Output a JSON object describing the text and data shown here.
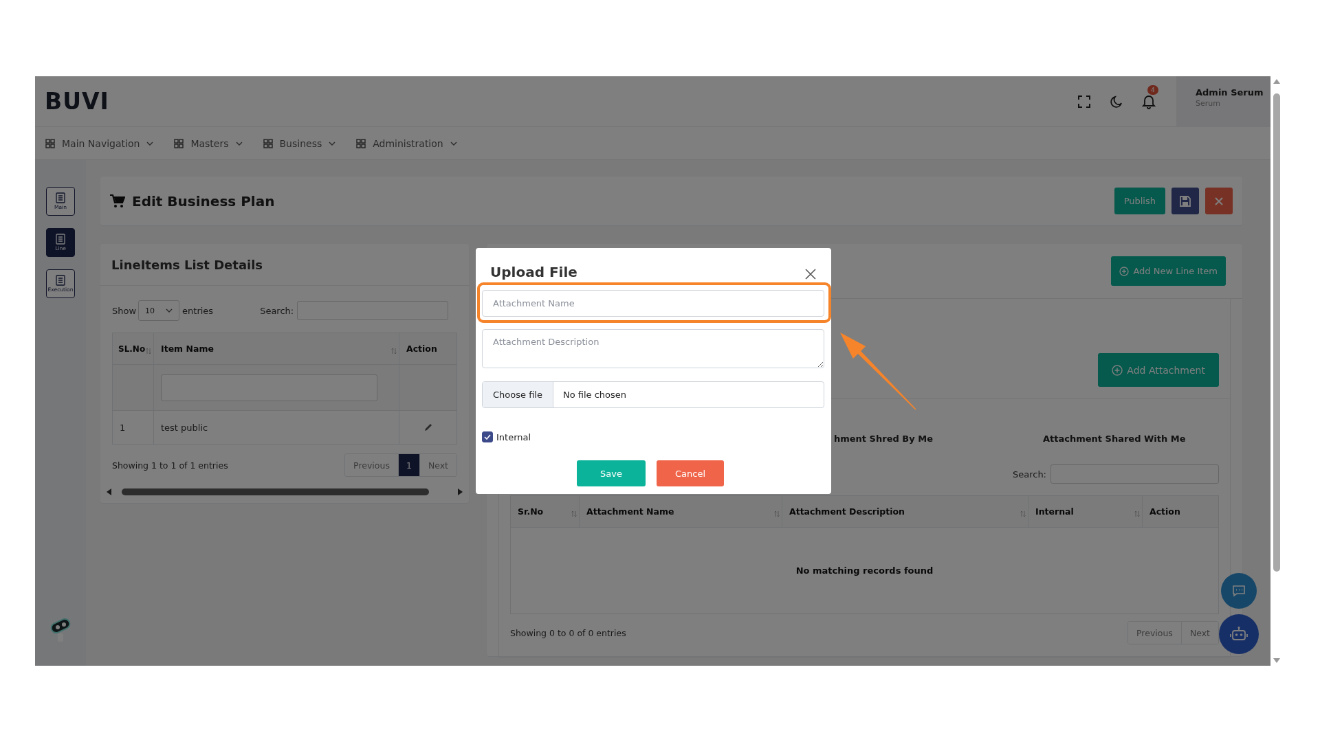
{
  "header": {
    "logo": "BUVI",
    "notification_count": "4",
    "user": {
      "name": "Admin Serum",
      "role": "Serum"
    }
  },
  "nav": [
    {
      "label": "Main Navigation"
    },
    {
      "label": "Masters"
    },
    {
      "label": "Business"
    },
    {
      "label": "Administration"
    }
  ],
  "side_rail": [
    {
      "label": "Main",
      "selected": false
    },
    {
      "label": "Line",
      "selected": true
    },
    {
      "label": "Execution",
      "selected": false
    }
  ],
  "page": {
    "title": "Edit Business Plan",
    "buttons": [
      {
        "kind": "publish",
        "label": "Publish"
      },
      {
        "kind": "save"
      },
      {
        "kind": "close"
      }
    ]
  },
  "line_items": {
    "title": "LineItems List Details",
    "show_label": "Show",
    "page_size": "10",
    "entries_label": "entries",
    "search_label": "Search:",
    "columns": [
      {
        "label": "SL.No",
        "sortable": true
      },
      {
        "label": "Item Name",
        "sortable": true
      },
      {
        "label": "Action",
        "sortable": false
      }
    ],
    "rows": [
      {
        "sl_no": "1",
        "item_name": "test public"
      }
    ],
    "info": "Showing 1 to 1 of 1 entries",
    "pager": {
      "previous": "Previous",
      "pages": [
        {
          "label": "1",
          "selected": true
        }
      ],
      "next": "Next"
    }
  },
  "attachments": {
    "add_line_item": "Add New Line Item",
    "add_attachment": "Add Attachment",
    "tabs": [
      {
        "label": "hment Shred By Me"
      },
      {
        "label": "Attachment Shared With Me"
      }
    ],
    "search_label": "Search:",
    "columns": [
      {
        "label": "Sr.No",
        "sortable": true
      },
      {
        "label": "Attachment Name",
        "sortable": true
      },
      {
        "label": "Attachment Description",
        "sortable": true
      },
      {
        "label": "Internal",
        "sortable": true
      },
      {
        "label": "Action",
        "sortable": false
      }
    ],
    "empty_message": "No matching records found",
    "info": "Showing 0 to 0 of 0 entries",
    "pager": {
      "previous": "Previous",
      "next": "Next"
    }
  },
  "modal": {
    "title": "Upload File",
    "name_placeholder": "Attachment Name",
    "description_placeholder": "Attachment Description",
    "file_button": "Choose file",
    "file_status": "No file chosen",
    "internal": {
      "label": "Internal",
      "checked": true
    },
    "buttons": [
      {
        "kind": "save",
        "label": "Save"
      },
      {
        "kind": "cancel",
        "label": "Cancel"
      }
    ]
  }
}
